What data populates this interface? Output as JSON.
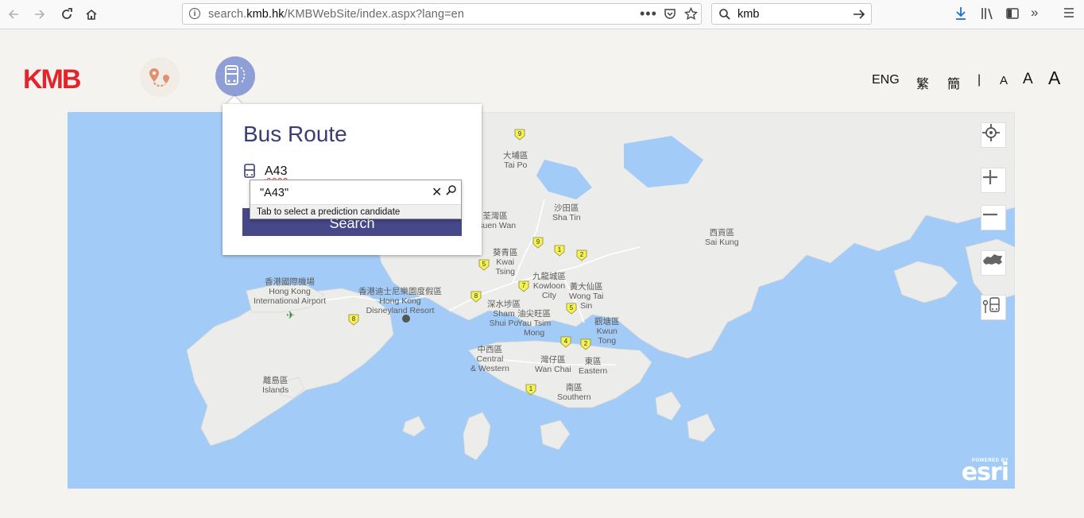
{
  "browser": {
    "url_prefix": "search.",
    "url_domain": "kmb.hk",
    "url_path": "/KMBWebSite/index.aspx?lang=en",
    "search_value": "kmb",
    "icons": {
      "back": "back-arrow-icon",
      "forward": "forward-arrow-icon",
      "reload": "reload-icon",
      "home": "home-icon",
      "page_actions": "more-icon",
      "pocket": "pocket-icon",
      "bookmark": "star-icon",
      "download": "download-icon",
      "library": "library-icon",
      "sidebar": "sidebar-icon",
      "overflow": "chevron-double-right-icon",
      "menu": "hamburger-icon"
    }
  },
  "header": {
    "logo_text": "KMB",
    "languages": [
      "ENG",
      "繁",
      "簡"
    ],
    "separator": "|",
    "font_sizes": [
      "A",
      "A",
      "A"
    ]
  },
  "panel": {
    "title": "Bus Route",
    "route_value": "A43",
    "search_label": "Search"
  },
  "ime": {
    "candidate": "\"A43\"",
    "hint": "Tab to select a prediction candidate"
  },
  "map": {
    "labels": {
      "tai_po_zh": "大埔區",
      "tai_po_en": "Tai Po",
      "sha_tin_zh": "沙田區",
      "sha_tin_en": "Sha Tin",
      "tsuen_wan_zh": "荃灣區",
      "tsuen_wan_en": "Tsuen Wan",
      "sai_kung_zh": "西貢區",
      "sai_kung_en": "Sai Kung",
      "kwai_tsing_zh": "葵青區",
      "kwai_tsing_en1": "Kwai",
      "kwai_tsing_en2": "Tsing",
      "kowloon_city_zh": "九龍城區",
      "kowloon_city_en1": "Kowloon",
      "kowloon_city_en2": "City",
      "wong_tai_sin_zh": "黃大仙區",
      "wong_tai_sin_en1": "Wong Tai",
      "wong_tai_sin_en2": "Sin",
      "airport_zh": "香港國際機場",
      "airport_en1": "Hong Kong",
      "airport_en2": "International Airport",
      "disney_zh": "香港迪士尼樂園度假區",
      "disney_en1": "Hong Kong",
      "disney_en2": "Disneyland Resort",
      "ssp_zh": "深水埗區",
      "ssp_en1": "Sham",
      "ssp_en2": "Shui Po",
      "ytm_zh": "油尖旺區",
      "ytm_en1": "Yau Tsim",
      "ytm_en2": "Mong",
      "kwun_tong_zh": "觀塘區",
      "kwun_tong_en1": "Kwun",
      "kwun_tong_en2": "Tong",
      "central_zh": "中西區",
      "central_en1": "Central",
      "central_en2": "& Western",
      "wan_chai_zh": "灣仔區",
      "wan_chai_en": "Wan Chai",
      "eastern_zh": "東區",
      "eastern_en": "Eastern",
      "islands_zh": "離島區",
      "islands_en": "Islands",
      "southern_zh": "南區",
      "southern_en": "Southern"
    },
    "route_shields": [
      "9",
      "9",
      "1",
      "2",
      "5",
      "7",
      "8",
      "5",
      "8",
      "4",
      "2",
      "1"
    ],
    "controls": {
      "locate": "locate-icon",
      "zoom_in": "plus-icon",
      "zoom_out": "minus-icon",
      "overview": "hong-kong-map-icon",
      "bus_stop": "bus-stop-icon"
    },
    "attribution_top": "POWERED BY",
    "attribution_brand": "esri"
  },
  "colors": {
    "brand_red": "#e3242b",
    "panel_title": "#3a3d73",
    "search_button": "#474889",
    "water": "#a3cbf7",
    "land": "#ececea",
    "shield": "#f6f251"
  }
}
